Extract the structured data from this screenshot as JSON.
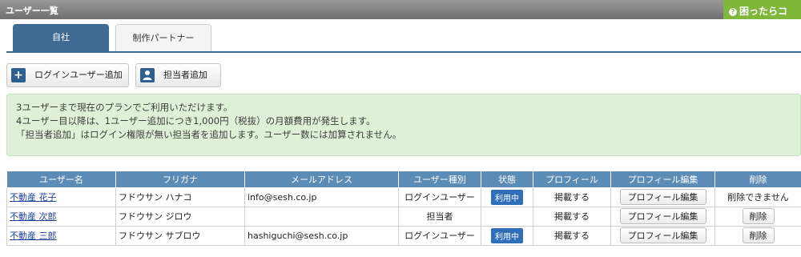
{
  "header": {
    "title": "ユーザー一覧",
    "help_label": "困ったらコ"
  },
  "tabs": [
    {
      "label": "自社"
    },
    {
      "label": "制作パートナー"
    }
  ],
  "buttons": {
    "add_login_user": "ログインユーザー追加",
    "add_contact": "担当者追加"
  },
  "info": {
    "lines": [
      "3ユーザーまで現在のプランでご利用いただけます。",
      "4ユーザー目以降は、1ユーザー追加につき1,000円（税抜）の月額費用が発生します。",
      "「担当者追加」はログイン権限が無い担当者を追加します。ユーザー数には加算されません。"
    ]
  },
  "table": {
    "headers": [
      "ユーザー名",
      "フリガナ",
      "メールアドレス",
      "ユーザー種別",
      "状態",
      "プロフィール",
      "プロフィール編集",
      "削除"
    ],
    "rows": [
      {
        "name": "不動産 花子",
        "kana": "フドウサン ハナコ",
        "email": "info@sesh.co.jp",
        "type": "ログインユーザー",
        "status": "利用中",
        "profile": "掲載する",
        "edit": "プロフィール編集",
        "delete": "削除できません"
      },
      {
        "name": "不動産 次郎",
        "kana": "フドウサン ジロウ",
        "email": "",
        "type": "担当者",
        "status": "",
        "profile": "掲載する",
        "edit": "プロフィール編集",
        "delete": "削除"
      },
      {
        "name": "不動産 三郎",
        "kana": "フドウサン サブロウ",
        "email": "hashiguchi@sesh.co.jp",
        "type": "ログインユーザー",
        "status": "利用中",
        "profile": "掲載する",
        "edit": "プロフィール編集",
        "delete": "削除"
      }
    ]
  }
}
